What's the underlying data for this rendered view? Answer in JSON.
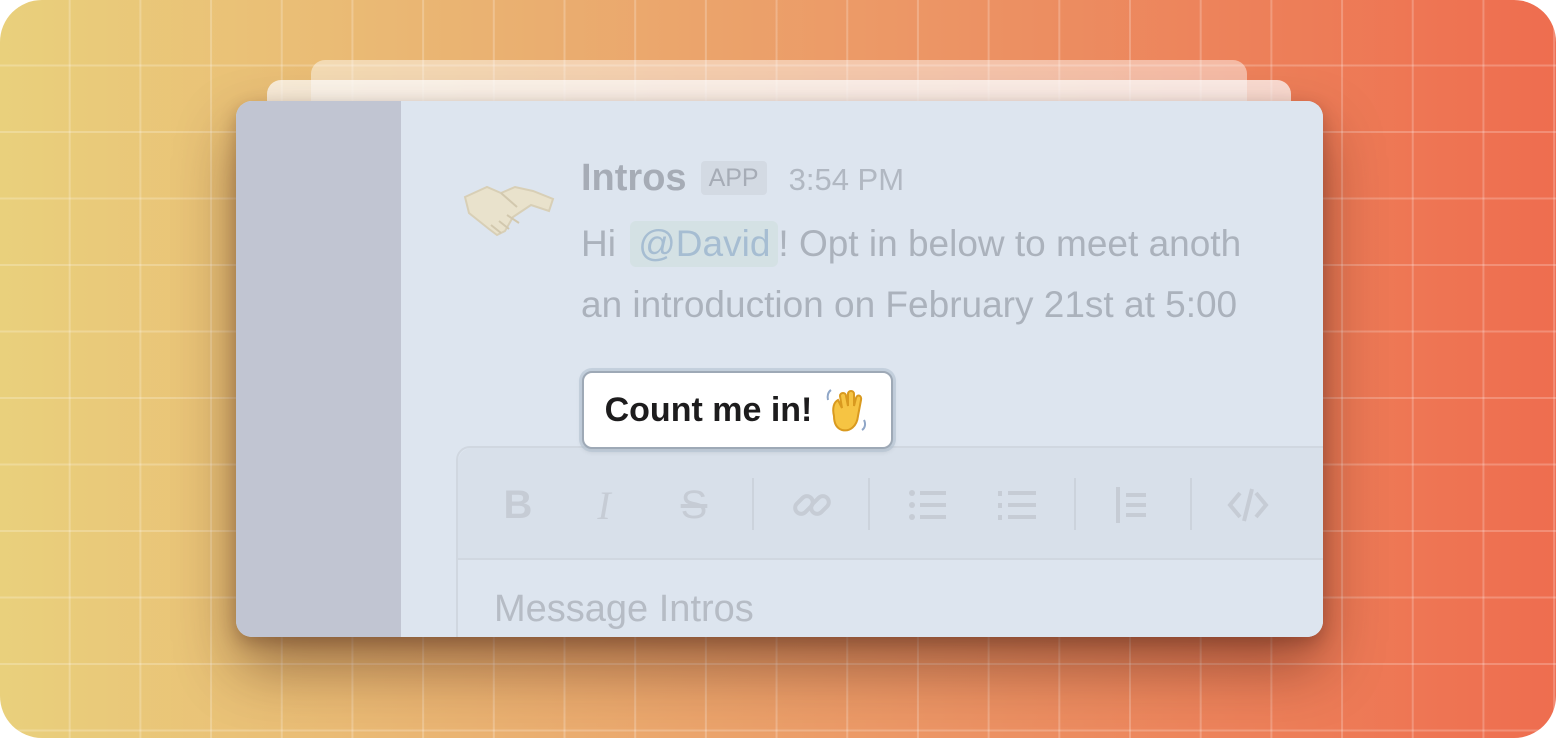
{
  "message": {
    "sender": "Intros",
    "badge": "APP",
    "time": "3:54 PM",
    "greeting": "Hi",
    "mention": "@David",
    "line1_rest": "! Opt in below to meet anoth",
    "line2": "an introduction on February 21st at 5:00"
  },
  "cta": {
    "label": "Count me in!",
    "emoji_icon": "waving-hand-icon"
  },
  "composer": {
    "placeholder": "Message Intros",
    "tools": [
      "bold-icon",
      "italic-icon",
      "strikethrough-icon",
      "link-icon",
      "bulleted-list-icon",
      "numbered-list-icon",
      "blockquote-icon",
      "code-icon"
    ]
  },
  "colors": {
    "accent_bg": "#dde5ef",
    "sidebar": "#c1c5d2"
  }
}
